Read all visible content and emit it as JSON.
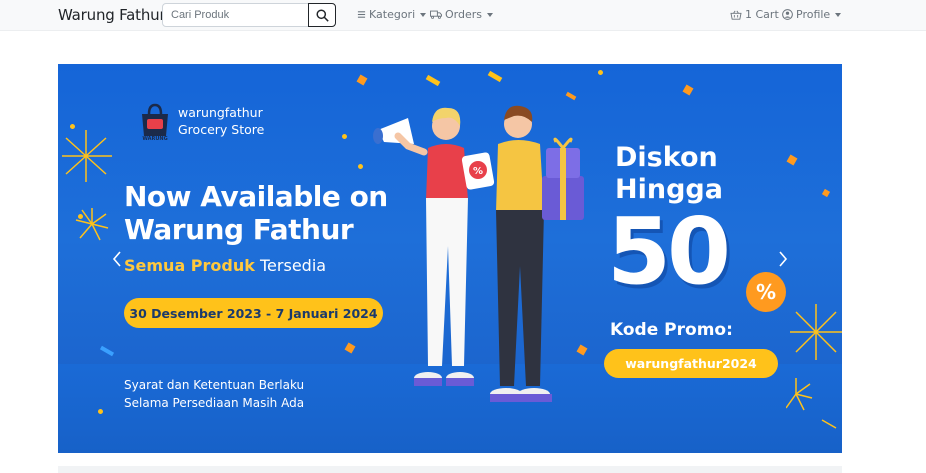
{
  "navbar": {
    "brand": "Warung Fathur",
    "search_placeholder": "Cari Produk",
    "kategori": "Kategori",
    "orders": "Orders",
    "cart": "1 Cart",
    "profile": "Profile"
  },
  "banner": {
    "store_name_line1": "warungfathur",
    "store_name_line2": "Grocery Store",
    "logo_text": "WARUNG",
    "headline_line1": "Now Available on",
    "headline_line2": "Warung Fathur",
    "sub_highlight": "Semua Produk",
    "sub_rest": "Tersedia",
    "date_range": "30 Desember 2023 - 7 Januari 2024",
    "terms_line1": "Syarat dan Ketentuan Berlaku",
    "terms_line2": "Selama Persediaan Masih Ada",
    "diskon_line1": "Diskon",
    "diskon_line2": "Hingga",
    "discount_value": "50",
    "percent": "%",
    "kode_label": "Kode Promo:",
    "kode_value": "warungfathur2024",
    "sign_text": "%"
  },
  "colors": {
    "banner_blue": "#1e6fd9",
    "accent_yellow": "#ffc21a",
    "accent_orange": "#ff9a1f"
  },
  "icons": {
    "search": "search-icon",
    "kategori": "list-icon",
    "orders": "truck-icon",
    "cart": "basket-icon",
    "profile": "user-circle-icon",
    "prev": "chevron-left-icon",
    "next": "chevron-right-icon"
  }
}
